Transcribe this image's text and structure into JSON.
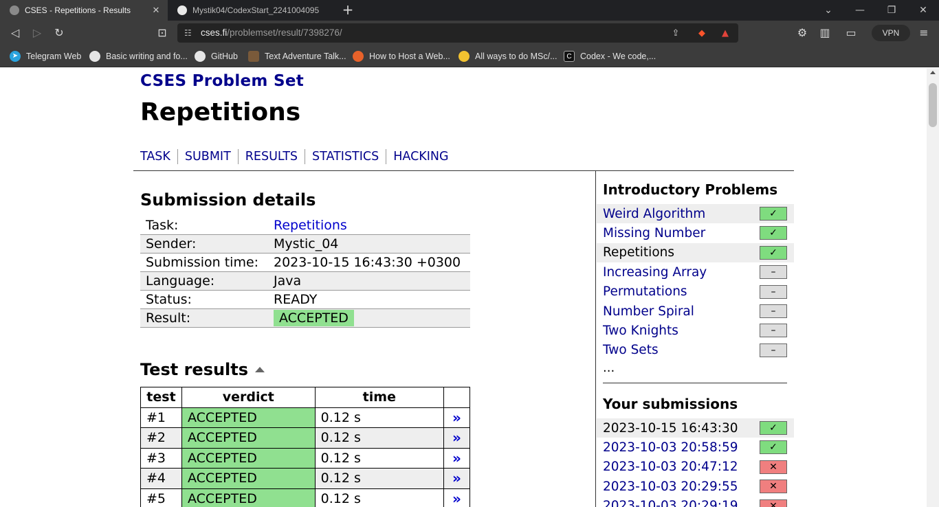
{
  "browser": {
    "tabs": [
      {
        "title": "CSES - Repetitions - Results",
        "active": true
      },
      {
        "title": "Mystik04/CodexStart_2241004095",
        "active": false
      }
    ],
    "url_host": "cses.fi",
    "url_path": "/problemset/result/7398276/",
    "vpn_label": "VPN",
    "bookmarks": [
      {
        "label": "Telegram Web",
        "icon": "telegram-icon"
      },
      {
        "label": "Basic writing and fo...",
        "icon": "github-icon"
      },
      {
        "label": "GitHub",
        "icon": "github-icon"
      },
      {
        "label": "Text Adventure Talk...",
        "icon": "avatar-icon"
      },
      {
        "label": "How to Host a Web...",
        "icon": "hosting-icon"
      },
      {
        "label": "All ways to do MSc/...",
        "icon": "clock-icon"
      },
      {
        "label": "Codex - We code,...",
        "icon": "codex-icon"
      }
    ]
  },
  "site": {
    "title": "CSES Problem Set",
    "task_title": "Repetitions",
    "nav": [
      "TASK",
      "SUBMIT",
      "RESULTS",
      "STATISTICS",
      "HACKING"
    ]
  },
  "details": {
    "heading": "Submission details",
    "rows": [
      {
        "key": "Task:",
        "value": "Repetitions",
        "link": true
      },
      {
        "key": "Sender:",
        "value": "Mystic_04"
      },
      {
        "key": "Submission time:",
        "value": "2023-10-15 16:43:30 +0300"
      },
      {
        "key": "Language:",
        "value": "Java"
      },
      {
        "key": "Status:",
        "value": "READY"
      },
      {
        "key": "Result:",
        "value": "ACCEPTED",
        "badge": true
      }
    ]
  },
  "tests": {
    "heading": "Test results",
    "columns": [
      "test",
      "verdict",
      "time",
      ""
    ],
    "rows": [
      {
        "num": "#1",
        "verdict": "ACCEPTED",
        "time": "0.12 s",
        "go": "»"
      },
      {
        "num": "#2",
        "verdict": "ACCEPTED",
        "time": "0.12 s",
        "go": "»"
      },
      {
        "num": "#3",
        "verdict": "ACCEPTED",
        "time": "0.12 s",
        "go": "»"
      },
      {
        "num": "#4",
        "verdict": "ACCEPTED",
        "time": "0.12 s",
        "go": "»"
      },
      {
        "num": "#5",
        "verdict": "ACCEPTED",
        "time": "0.12 s",
        "go": "»"
      }
    ]
  },
  "sidebar": {
    "problems_heading": "Introductory Problems",
    "problems": [
      {
        "label": "Weird Algorithm",
        "status": "ok",
        "mark": "✓"
      },
      {
        "label": "Missing Number",
        "status": "ok",
        "mark": "✓"
      },
      {
        "label": "Repetitions",
        "status": "ok",
        "mark": "✓",
        "current": true
      },
      {
        "label": "Increasing Array",
        "status": "none",
        "mark": "–"
      },
      {
        "label": "Permutations",
        "status": "none",
        "mark": "–"
      },
      {
        "label": "Number Spiral",
        "status": "none",
        "mark": "–"
      },
      {
        "label": "Two Knights",
        "status": "none",
        "mark": "–"
      },
      {
        "label": "Two Sets",
        "status": "none",
        "mark": "–"
      }
    ],
    "more": "...",
    "submissions_heading": "Your submissions",
    "submissions": [
      {
        "label": "2023-10-15 16:43:30",
        "status": "ok",
        "mark": "✓",
        "current": true
      },
      {
        "label": "2023-10-03 20:58:59",
        "status": "ok",
        "mark": "✓"
      },
      {
        "label": "2023-10-03 20:47:12",
        "status": "fail",
        "mark": "✕"
      },
      {
        "label": "2023-10-03 20:29:55",
        "status": "fail",
        "mark": "✕"
      },
      {
        "label": "2023-10-03 20:29:19",
        "status": "fail",
        "mark": "✕"
      }
    ]
  },
  "colors": {
    "link": "#00008b",
    "accepted": "#90e090",
    "ok_mark": "#7fdc7f",
    "fail_mark": "#f07f7f"
  }
}
